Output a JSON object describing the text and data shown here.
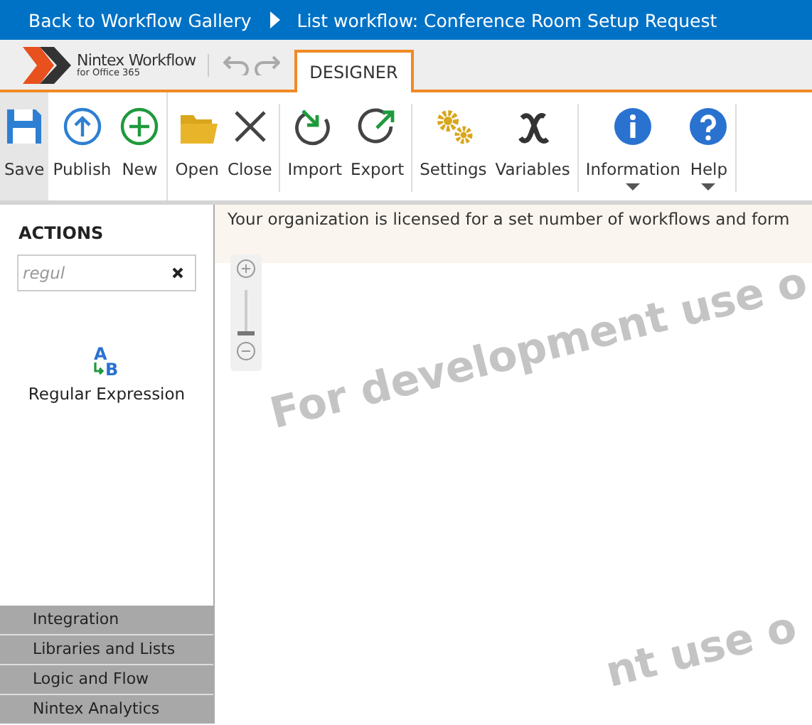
{
  "breadcrumb": {
    "back": "Back to Workflow Gallery",
    "current": "List workflow: Conference Room Setup Request"
  },
  "logo": {
    "name": "Nintex Workflow",
    "sub": "for Office 365"
  },
  "tabs": [
    {
      "label": "DESIGNER",
      "selected": true
    }
  ],
  "toolbar": [
    [
      {
        "kind": "save",
        "label": "Save",
        "selected": true,
        "dropdown": false
      },
      {
        "kind": "publish",
        "label": "Publish",
        "selected": false,
        "dropdown": false
      },
      {
        "kind": "new",
        "label": "New",
        "selected": false,
        "dropdown": false
      }
    ],
    [
      {
        "kind": "open",
        "label": "Open",
        "selected": false,
        "dropdown": false
      },
      {
        "kind": "close",
        "label": "Close",
        "selected": false,
        "dropdown": false
      }
    ],
    [
      {
        "kind": "import",
        "label": "Import",
        "selected": false,
        "dropdown": false
      },
      {
        "kind": "export",
        "label": "Export",
        "selected": false,
        "dropdown": false
      }
    ],
    [
      {
        "kind": "settings",
        "label": "Settings",
        "selected": false,
        "dropdown": false
      },
      {
        "kind": "variables",
        "label": "Variables",
        "selected": false,
        "dropdown": false
      }
    ],
    [
      {
        "kind": "info",
        "label": "Information",
        "selected": false,
        "dropdown": true
      },
      {
        "kind": "help",
        "label": "Help",
        "selected": false,
        "dropdown": true
      }
    ]
  ],
  "sidebar": {
    "title": "ACTIONS",
    "search": {
      "value": "regul"
    },
    "actions": [
      {
        "label": "Regular Expression",
        "icon_letters": [
          "A",
          "B"
        ]
      }
    ],
    "categories": [
      {
        "label": "Integration"
      },
      {
        "label": "Libraries and Lists"
      },
      {
        "label": "Logic and Flow"
      },
      {
        "label": "Nintex Analytics"
      }
    ]
  },
  "notice": "Your organization is licensed for a set number of workflows and form",
  "zoom": {
    "level": 0
  },
  "watermarks": [
    "For development use o",
    "nt use o"
  ]
}
